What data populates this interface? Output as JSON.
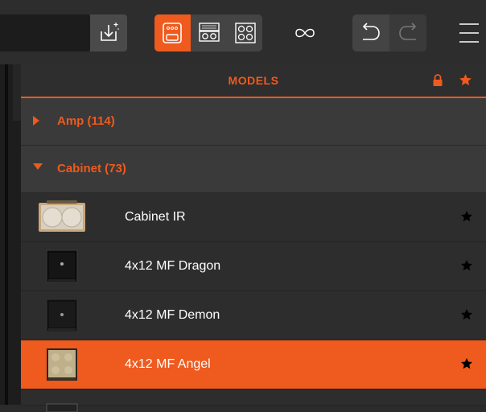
{
  "toolbar": {
    "search_value": "",
    "icons": [
      "import-icon",
      "stompbox-view-icon",
      "rack-view-icon",
      "cabinet-view-icon",
      "link-icon",
      "undo-icon",
      "redo-icon",
      "menu-icon"
    ],
    "active_view": "stompbox"
  },
  "panel": {
    "title": "MODELS",
    "header_icons": [
      "lock-icon",
      "star-icon"
    ]
  },
  "categories": [
    {
      "label": "Amp (114)",
      "expanded": false
    },
    {
      "label": "Cabinet (73)",
      "expanded": true
    }
  ],
  "models": [
    {
      "label": "Cabinet IR",
      "thumb": "cabinet-2x12-icon",
      "selected": false
    },
    {
      "label": "4x12 MF Dragon",
      "thumb": "cabinet-black-icon",
      "selected": false
    },
    {
      "label": "4x12 MF Demon",
      "thumb": "cabinet-black-icon",
      "selected": false
    },
    {
      "label": "4x12 MF Angel",
      "thumb": "cabinet-tan-icon",
      "selected": true
    }
  ],
  "colors": {
    "accent": "#ef5a1e",
    "panel": "#323232",
    "row": "#2d2d2d"
  }
}
